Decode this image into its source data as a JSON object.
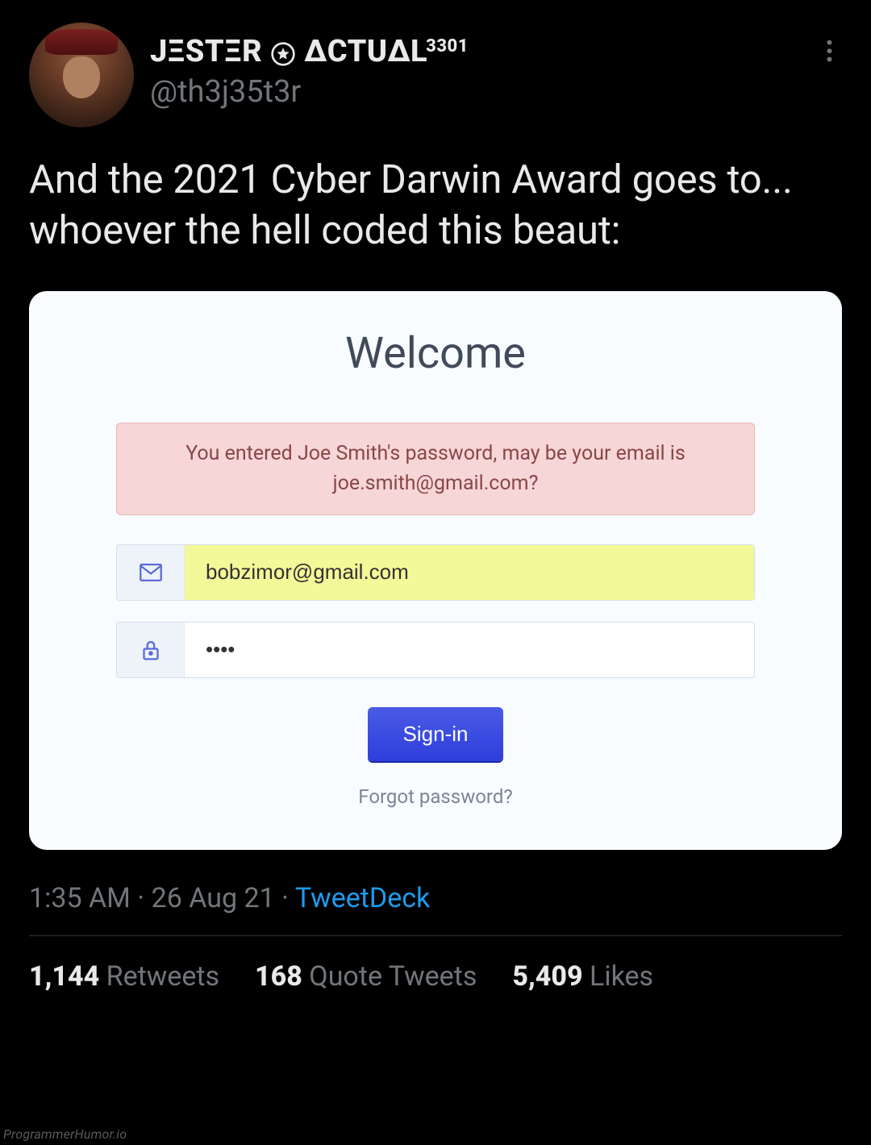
{
  "user": {
    "display_name_1": "JΞSTΞR",
    "display_name_2": "ΔCTUΔL",
    "display_name_sup": "3301",
    "handle": "@th3j35t3r"
  },
  "tweet_text": "And the 2021 Cyber Darwin Award goes to... whoever the hell coded this beaut:",
  "login": {
    "title": "Welcome",
    "error_message": "You entered Joe Smith's password, may be your email is joe.smith@gmail.com?",
    "email_value": "bobzimor@gmail.com",
    "password_value": "••••",
    "signin_label": "Sign-in",
    "forgot_label": "Forgot password?"
  },
  "meta": {
    "time": "1:35 AM",
    "date": "26 Aug 21",
    "source": "TweetDeck",
    "separator": " · "
  },
  "stats": {
    "retweets_count": "1,144",
    "retweets_label": "Retweets",
    "quotes_count": "168",
    "quotes_label": "Quote Tweets",
    "likes_count": "5,409",
    "likes_label": "Likes"
  },
  "watermark": "ProgrammerHumor.io"
}
